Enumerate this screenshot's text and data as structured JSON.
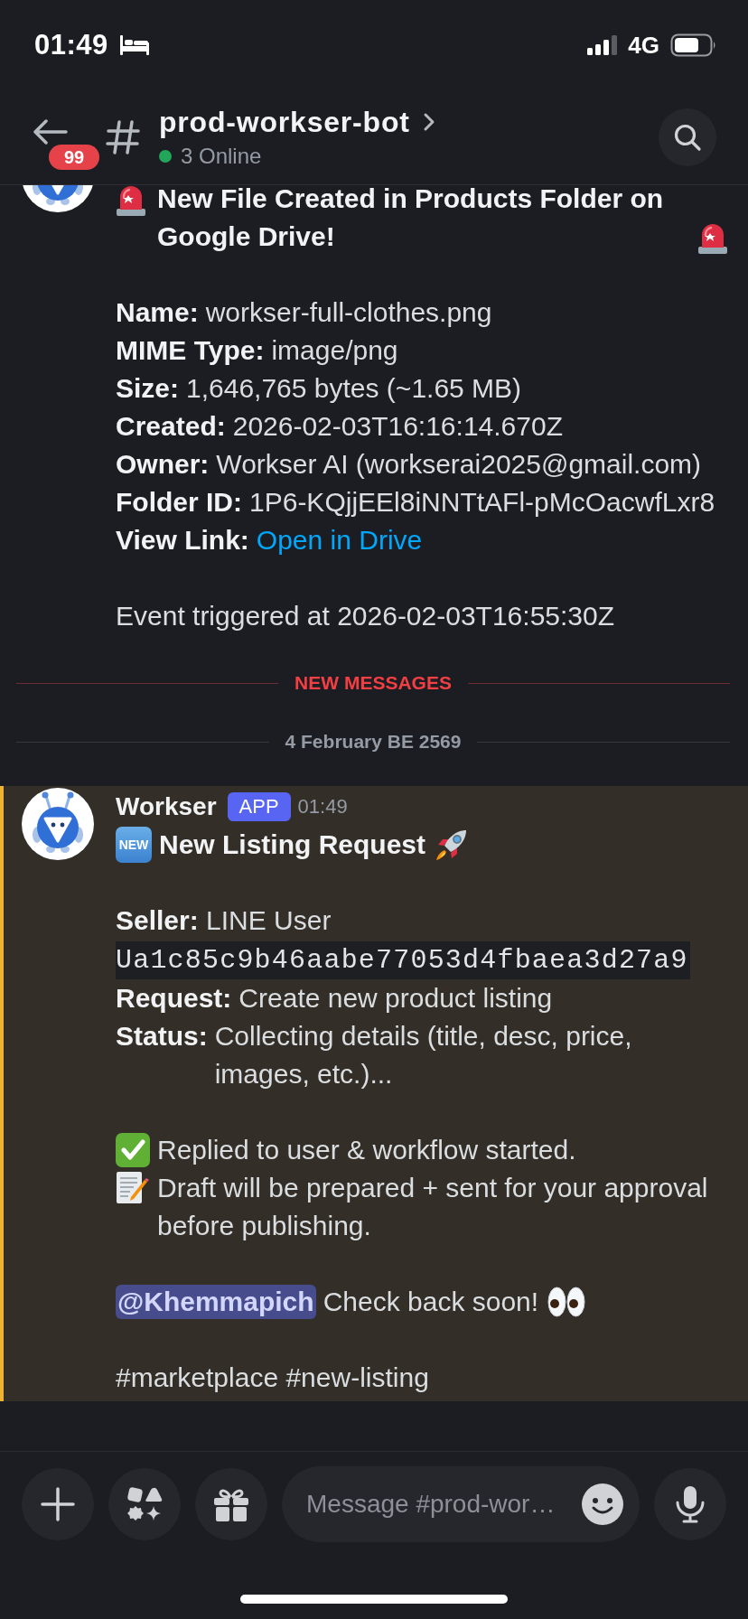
{
  "status_bar": {
    "time": "01:49",
    "network": "4G"
  },
  "header": {
    "unread_count": "99",
    "channel_name": "prod-workser-bot",
    "online_count": "3 Online"
  },
  "timeline": [
    {
      "kind": "message",
      "mentioned": false,
      "title": {
        "kind": "alert",
        "text": "New File Created in Products Folder on Google Drive!"
      },
      "sections": [
        [
          {
            "kind": "field",
            "label": "Name:",
            "value": "workser-full-clothes.png"
          },
          {
            "kind": "field",
            "label": "MIME Type:",
            "value": "image/png"
          },
          {
            "kind": "field",
            "label": "Size:",
            "value": "1,646,765 bytes (~1.65 MB)"
          },
          {
            "kind": "field",
            "label": "Created:",
            "value": "2026-02-03T16:16:14.670Z"
          },
          {
            "kind": "field",
            "label": "Owner:",
            "value": "Workser AI (workserai2025@gmail.com)"
          },
          {
            "kind": "field",
            "label": "Folder ID:",
            "value": "1P6-KQjjEEl8iNNTtAFl-pMcOacwfLxr8"
          },
          {
            "kind": "link_field",
            "label": "View Link:",
            "link": "Open in Drive"
          }
        ],
        [
          {
            "kind": "text",
            "text": "Event triggered at 2026-02-03T16:55:30Z"
          }
        ]
      ]
    },
    {
      "kind": "new_divider",
      "label": "NEW MESSAGES"
    },
    {
      "kind": "date_divider",
      "label": "4 February BE 2569"
    },
    {
      "kind": "message",
      "mentioned": true,
      "author": {
        "name": "Workser",
        "tag": "APP",
        "time": "01:49"
      },
      "title": {
        "kind": "new",
        "badge": "NEW",
        "text": "New Listing Request"
      },
      "sections": [
        [
          {
            "kind": "code_field",
            "label": "Seller:",
            "value": "LINE User",
            "code": "Ua1c85c9b46aabe77053d4fbaea3d27a9"
          },
          {
            "kind": "field",
            "label": "Request:",
            "value": "Create new product listing"
          },
          {
            "kind": "field",
            "label": "Status:",
            "value": "Collecting details (title, desc, price, images, etc.)..."
          }
        ],
        [
          {
            "kind": "check_note",
            "text": "Replied to user & workflow started."
          },
          {
            "kind": "memo_note",
            "text": "Draft will be prepared + sent for your approval before publishing."
          }
        ],
        [
          {
            "kind": "mention",
            "mention": "@Khemmapich",
            "text": "Check back soon!"
          }
        ],
        [
          {
            "kind": "text",
            "text": "#marketplace #new-listing"
          }
        ]
      ]
    }
  ],
  "composer": {
    "placeholder": "Message #prod-wor…"
  }
}
